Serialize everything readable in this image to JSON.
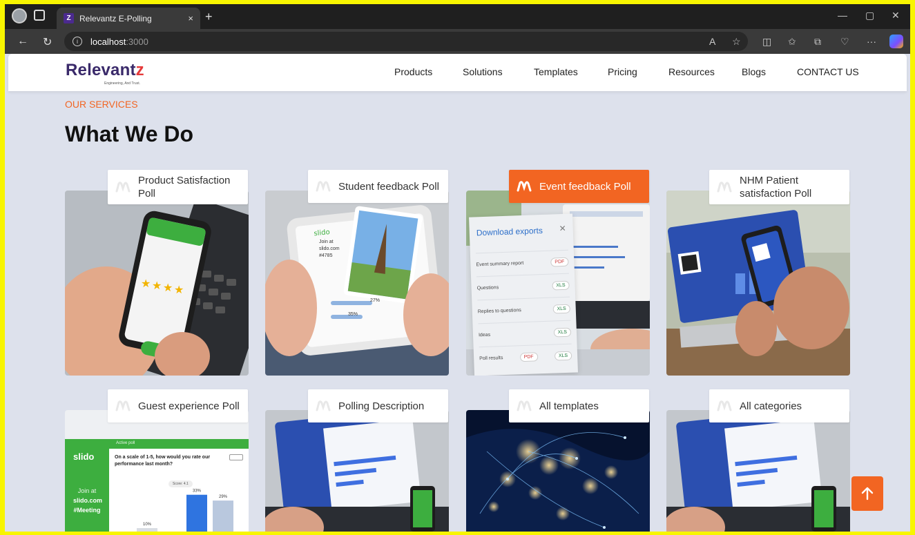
{
  "browser": {
    "tab_title": "Relevantz E-Polling",
    "tab_close": "×",
    "new_tab": "+",
    "url_host": "localhost",
    "url_port": ":3000"
  },
  "site": {
    "logo_main": "Relevant",
    "logo_z": "z",
    "tagline": "Engineering, And Trust.",
    "nav": [
      "Products",
      "Solutions",
      "Templates",
      "Pricing",
      "Resources",
      "Blogs",
      "CONTACT US"
    ]
  },
  "section": {
    "eyebrow": "OUR SERVICES",
    "title": "What We Do"
  },
  "cards": [
    {
      "label": "Product Satisfaction Poll",
      "active": false
    },
    {
      "label": "Student feedback Poll",
      "active": false
    },
    {
      "label": "Event feedback Poll",
      "active": true
    },
    {
      "label": "NHM Patient satisfaction Poll",
      "active": false
    },
    {
      "label": "Guest experience Poll",
      "active": false
    },
    {
      "label": "Polling Description",
      "active": false
    },
    {
      "label": "All templates",
      "active": false
    },
    {
      "label": "All categories",
      "active": false
    }
  ],
  "card2_popup": {
    "join_at": "Join at",
    "site": "slido.com",
    "code": "#4785",
    "pct": "27%",
    "pct2": "35%"
  },
  "exports_panel": {
    "title": "Download exports",
    "rows": [
      {
        "label": "Event summary report",
        "badge": "PDF"
      },
      {
        "label": "Questions",
        "badge": "XLS"
      },
      {
        "label": "Replies to questions",
        "badge": "XLS"
      },
      {
        "label": "Ideas",
        "badge": "XLS"
      },
      {
        "label": "Poll results",
        "badge": "PDF",
        "badge2": "XLS"
      }
    ]
  },
  "guest_poll": {
    "brand": "slido",
    "active_poll": "Active poll",
    "question": "On a scale of 1-5, how would you rate our performance last month?",
    "join_at": "Join at",
    "site": "slido.com",
    "code": "#Meeting",
    "score": "Score: 4.1",
    "bar_values": [
      "10%",
      "33%",
      "29%"
    ],
    "bar_levels": [
      0.1,
      0.33,
      0.29
    ]
  },
  "colors": {
    "accent": "#f26522",
    "brand_purple": "#3a2a6a",
    "slido_green": "#3dae3f",
    "page_bg": "#dde1ec"
  },
  "icons": {
    "card_label": "relevantz-m-icon",
    "scroll_top": "arrow-up-icon"
  }
}
